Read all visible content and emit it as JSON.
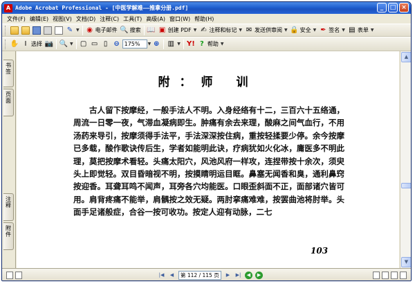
{
  "window": {
    "title": "Adobe Acrobat Professional - [中医学解难——推拿分册.pdf]",
    "app_icon": "adobe-acrobat-icon"
  },
  "menu": {
    "items": [
      "文件(F)",
      "编辑(E)",
      "视图(V)",
      "文档(D)",
      "注释(C)",
      "工具(T)",
      "高级(A)",
      "窗口(W)",
      "帮助(H)"
    ]
  },
  "toolbar1": {
    "email_label": "电子邮件",
    "search_label": "搜索",
    "create_pdf_label": "创建 PDF",
    "comment_label": "注释和标记",
    "review_label": "发送供审阅",
    "security_label": "安全",
    "sign_label": "签名",
    "forms_label": "表单"
  },
  "toolbar2": {
    "select_label": "选择",
    "zoom_value": "175%",
    "help_label": "帮助"
  },
  "navpane": {
    "bookmarks_label": "书签",
    "pages_label": "页面",
    "comments_label": "注释",
    "attachments_label": "附件"
  },
  "document": {
    "chapter_title": "附：师  训",
    "paragraph": "古人留下按摩经，一般手法人不明。入身经络有十二，三百六十五络通，周流一日零一夜，气滞血凝病即生。肿痛有余去来理，酸麻之间气血行，不用汤药来导引，按摩须得手法平，手法深深按住病，重按轻揉要少停。余今按摩已多载，酸作歌诀传后生，学者如能明此诀，疗病犹如火化冰，庸医多不明此理，莫把按摩术看轻。头痛太阳穴，风池风府一样攻，连捏带按十余次，须臾头上即觉轻。双目昏暗视不明，按摸睛明运目眶。鼻塞无闻香和臭，通利鼻窍按迎香。耳聋耳鸣不闻声，耳旁各穴均能医。口眼歪斜面不正，面部诸穴皆可用。肩背疼痛不能举，肩髃按之效无疑。两肘挛痛难难，按罢曲池将肘举。头面手足诸般症，合谷一按可收功。按定人迎有动脉，二七",
    "page_number": "103"
  },
  "statusbar": {
    "page_display": "第 112 / 115 页"
  }
}
